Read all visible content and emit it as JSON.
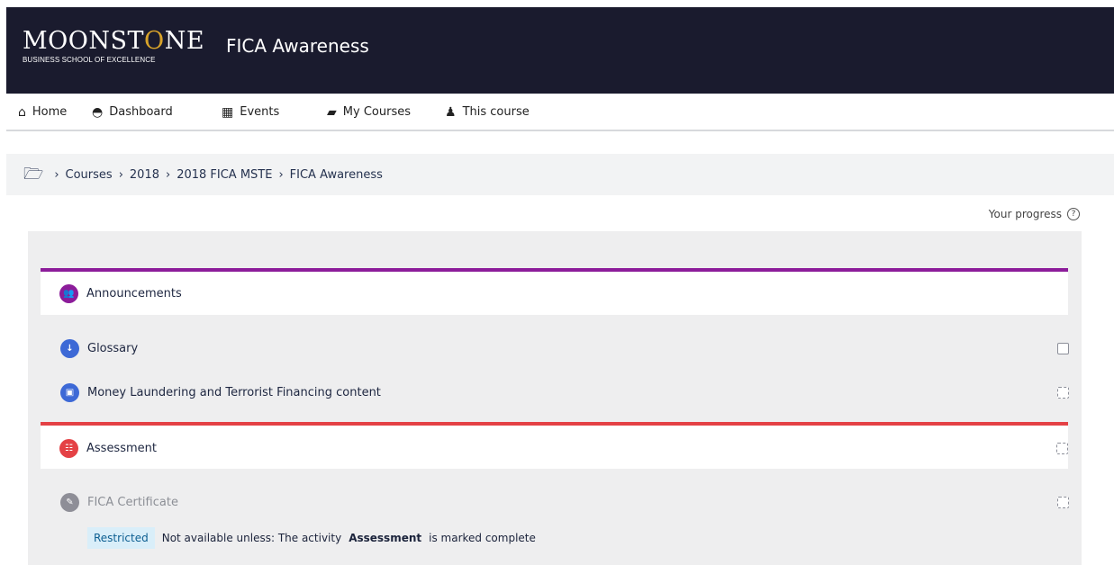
{
  "header": {
    "logo_main_a": "MOONST",
    "logo_main_b": "O",
    "logo_main_c": "NE",
    "logo_sub": "BUSINESS SCHOOL OF EXCELLENCE",
    "site_title": "FICA Awareness"
  },
  "nav": {
    "items": [
      {
        "label": "Home",
        "icon": "home-icon"
      },
      {
        "label": "Dashboard",
        "icon": "dashboard-icon"
      },
      {
        "label": "Events",
        "icon": "calendar-icon"
      },
      {
        "label": "My Courses",
        "icon": "briefcase-icon"
      },
      {
        "label": "This course",
        "icon": "sitemap-icon"
      }
    ]
  },
  "breadcrumb": {
    "items": [
      "Courses",
      "2018",
      "2018 FICA MSTE",
      "FICA Awareness"
    ]
  },
  "progress": {
    "label": "Your progress",
    "help_symbol": "?"
  },
  "course": {
    "sections": [
      {
        "title": "Announcements",
        "accent": "#8c1c9a"
      },
      {
        "title": "Assessment",
        "accent": "#e44145"
      }
    ],
    "activities": [
      {
        "title": "Glossary",
        "completion": "manual"
      },
      {
        "title": "Money Laundering and Terrorist Financing content",
        "completion": "automatic"
      },
      {
        "title": "FICA Certificate",
        "completion": "automatic"
      }
    ],
    "restriction": {
      "tag": "Restricted",
      "prefix": "Not available unless: The activity",
      "activity": "Assessment",
      "suffix": "is marked complete"
    }
  },
  "colors": {
    "header_bg": "#1a1b2e",
    "logo_accent": "#d8a32a",
    "announcements_accent": "#8c1c9a",
    "assessment_accent": "#e44145",
    "glossary_icon": "#3d69d6",
    "content_icon": "#3d69d6",
    "certificate_icon": "#8e8e97"
  }
}
